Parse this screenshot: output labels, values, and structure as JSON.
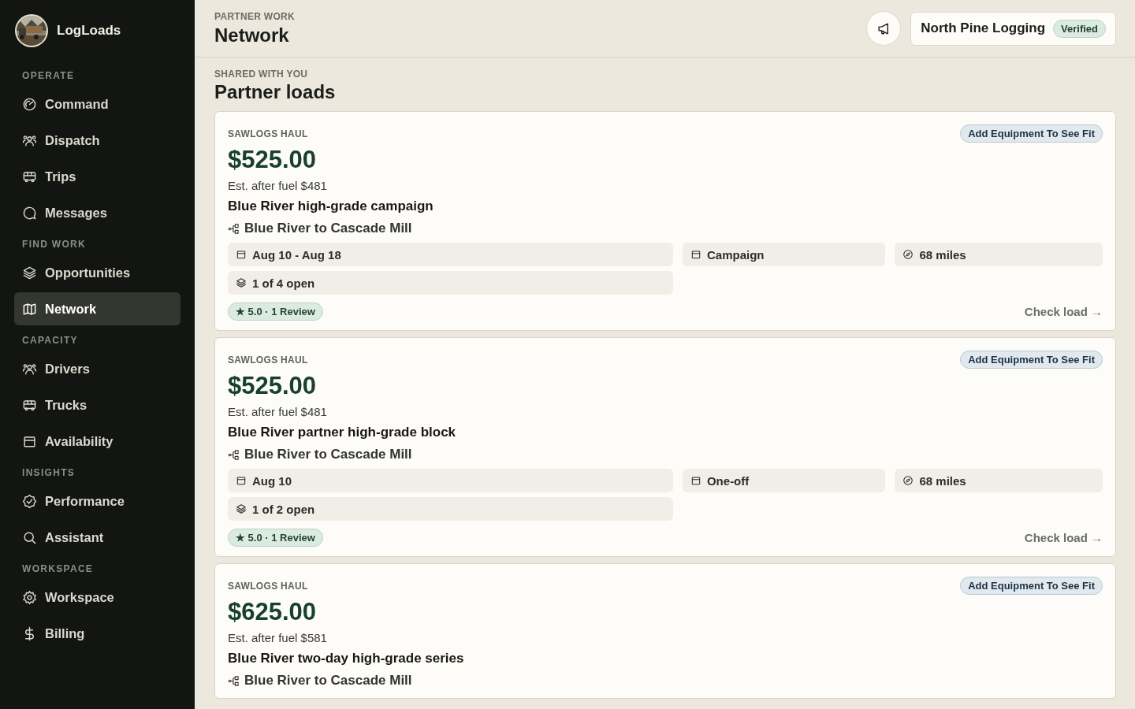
{
  "brand": {
    "name": "LogLoads"
  },
  "sidebar": {
    "sections": [
      {
        "label": "OPERATE",
        "items": [
          {
            "label": "Command",
            "selected": false
          },
          {
            "label": "Dispatch",
            "selected": false
          },
          {
            "label": "Trips",
            "selected": false
          },
          {
            "label": "Messages",
            "selected": false
          }
        ]
      },
      {
        "label": "FIND WORK",
        "items": [
          {
            "label": "Opportunities",
            "selected": false
          },
          {
            "label": "Network",
            "selected": true
          }
        ]
      },
      {
        "label": "CAPACITY",
        "items": [
          {
            "label": "Drivers",
            "selected": false
          },
          {
            "label": "Trucks",
            "selected": false
          },
          {
            "label": "Availability",
            "selected": false
          }
        ]
      },
      {
        "label": "INSIGHTS",
        "items": [
          {
            "label": "Performance",
            "selected": false
          },
          {
            "label": "Assistant",
            "selected": false
          }
        ]
      },
      {
        "label": "WORKSPACE",
        "items": [
          {
            "label": "Workspace",
            "selected": false
          },
          {
            "label": "Billing",
            "selected": false
          }
        ]
      }
    ]
  },
  "header": {
    "eyebrow": "PARTNER WORK",
    "title": "Network",
    "company": "North Pine Logging",
    "company_badge": "Verified"
  },
  "section": {
    "eyebrow": "SHARED WITH YOU",
    "title": "Partner loads"
  },
  "loads": [
    {
      "category": "SAWLOGS HAUL",
      "fit_badge": "Add Equipment To See Fit",
      "price": "$525.00",
      "after_fuel": "Est. after fuel $481",
      "title": "Blue River high-grade campaign",
      "route": "Blue River to Cascade Mill",
      "chips": [
        {
          "kind": "date",
          "text": "Aug 10 - Aug 18"
        },
        {
          "kind": "type",
          "text": "Campaign"
        },
        {
          "kind": "distance",
          "text": "68 miles"
        },
        {
          "kind": "slots",
          "text": "1 of 4 open"
        }
      ],
      "rating": "★ 5.0 · 1 Review",
      "action": "Check load →"
    },
    {
      "category": "SAWLOGS HAUL",
      "fit_badge": "Add Equipment To See Fit",
      "price": "$525.00",
      "after_fuel": "Est. after fuel $481",
      "title": "Blue River partner high-grade block",
      "route": "Blue River to Cascade Mill",
      "chips": [
        {
          "kind": "date",
          "text": "Aug 10"
        },
        {
          "kind": "type",
          "text": "One-off"
        },
        {
          "kind": "distance",
          "text": "68 miles"
        },
        {
          "kind": "slots",
          "text": "1 of 2 open"
        }
      ],
      "rating": "★ 5.0 · 1 Review",
      "action": "Check load →"
    },
    {
      "category": "SAWLOGS HAUL",
      "fit_badge": "Add Equipment To See Fit",
      "price": "$625.00",
      "after_fuel": "Est. after fuel $581",
      "title": "Blue River two-day high-grade series",
      "route": "Blue River to Cascade Mill"
    }
  ]
}
